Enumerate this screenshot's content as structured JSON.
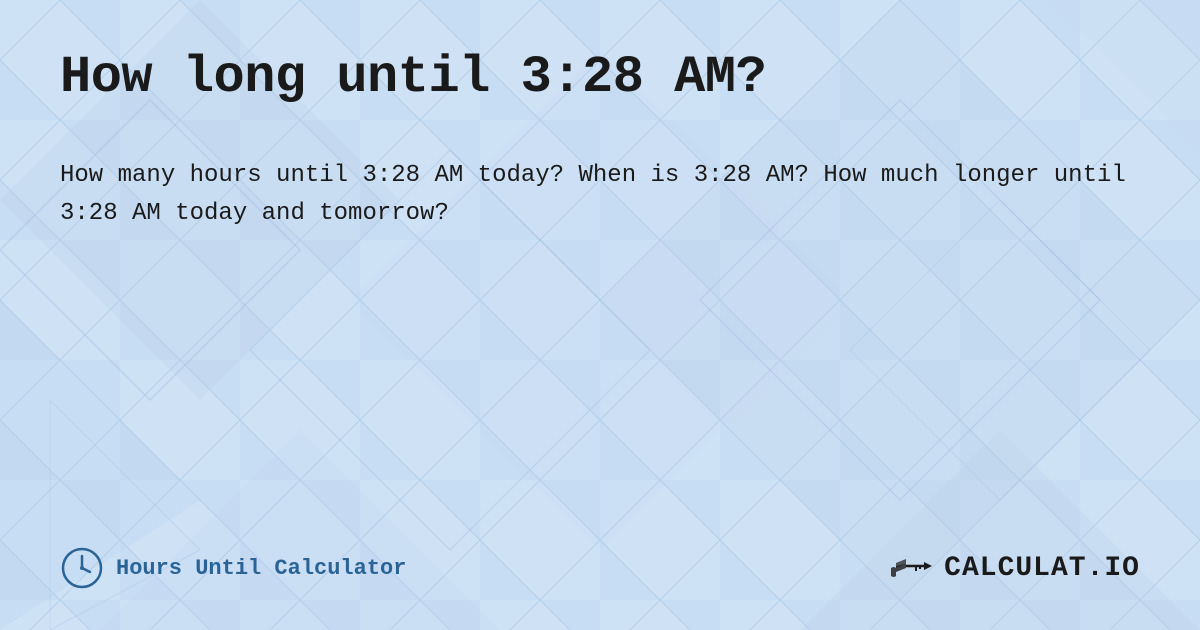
{
  "page": {
    "title": "How long until 3:28 AM?",
    "description": "How many hours until 3:28 AM today? When is 3:28 AM? How much longer until 3:28 AM today and tomorrow?",
    "background_color": "#c8dff5"
  },
  "footer": {
    "brand_name": "Hours Until Calculator",
    "logo_text": "CALCULAT.IO"
  }
}
